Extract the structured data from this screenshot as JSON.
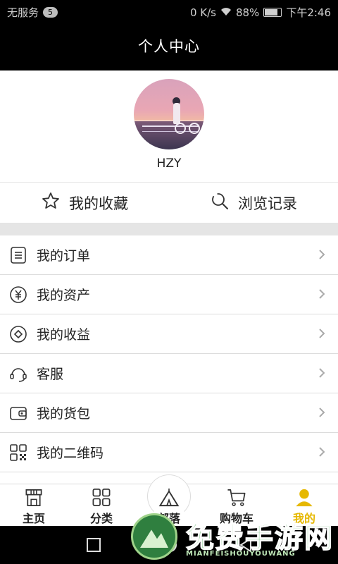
{
  "statusbar": {
    "carrier": "无服务",
    "badge": "5",
    "speed": "0 K/s",
    "battery": "88%",
    "time": "下午2:46"
  },
  "header": {
    "title": "个人中心"
  },
  "profile": {
    "username": "HZY"
  },
  "quick_links": [
    {
      "label": "我的收藏",
      "icon": "star-icon"
    },
    {
      "label": "浏览记录",
      "icon": "history-search-icon"
    }
  ],
  "menu": [
    {
      "label": "我的订单",
      "icon": "order-list-icon"
    },
    {
      "label": "我的资产",
      "icon": "yen-circle-icon"
    },
    {
      "label": "我的收益",
      "icon": "earnings-icon"
    },
    {
      "label": "客服",
      "icon": "headset-icon"
    },
    {
      "label": "我的货包",
      "icon": "wallet-icon"
    },
    {
      "label": "我的二维码",
      "icon": "qr-code-icon"
    }
  ],
  "tabs": [
    {
      "label": "主页",
      "icon": "storefront-icon"
    },
    {
      "label": "分类",
      "icon": "category-grid-icon"
    },
    {
      "label": "部落",
      "icon": "tent-icon"
    },
    {
      "label": "购物车",
      "icon": "cart-icon"
    },
    {
      "label": "我的",
      "icon": "user-icon",
      "active": true
    }
  ],
  "colors": {
    "active_tab": "#e6b800",
    "header_bg": "#000000",
    "separator": "#e5e5e5"
  },
  "watermark": {
    "title": "免费手游网",
    "subtitle": "MIANFEISHOUYOUWANG"
  }
}
